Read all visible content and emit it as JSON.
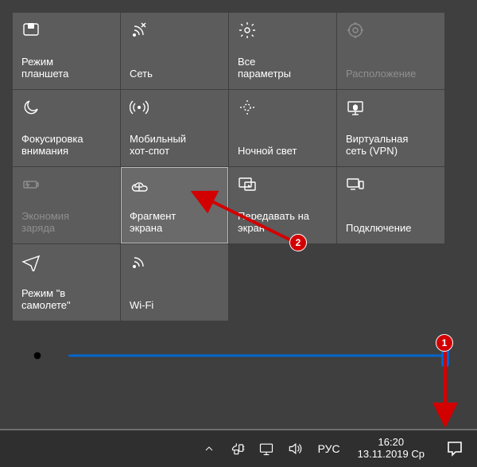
{
  "tiles": [
    {
      "id": "tablet-mode",
      "icon": "tablet-icon",
      "label": "Режим\nпланшета",
      "interactable": true,
      "disabled": false,
      "highlight": false
    },
    {
      "id": "network",
      "icon": "network-icon",
      "label": "Сеть",
      "interactable": true,
      "disabled": false,
      "highlight": false
    },
    {
      "id": "all-settings",
      "icon": "gear-icon",
      "label": "Все\nпараметры",
      "interactable": true,
      "disabled": false,
      "highlight": false
    },
    {
      "id": "location",
      "icon": "location-icon",
      "label": "Расположение",
      "interactable": false,
      "disabled": true,
      "highlight": false
    },
    {
      "id": "focus-assist",
      "icon": "moon-icon",
      "label": "Фокусировка\nвнимания",
      "interactable": true,
      "disabled": false,
      "highlight": false
    },
    {
      "id": "mobile-hotspot",
      "icon": "hotspot-icon",
      "label": "Мобильный\nхот-спот",
      "interactable": true,
      "disabled": false,
      "highlight": false
    },
    {
      "id": "night-light",
      "icon": "nightlight-icon",
      "label": "Ночной свет",
      "interactable": true,
      "disabled": false,
      "highlight": false
    },
    {
      "id": "vpn",
      "icon": "vpn-icon",
      "label": "Виртуальная\nсеть (VPN)",
      "interactable": true,
      "disabled": false,
      "highlight": false
    },
    {
      "id": "battery-saver",
      "icon": "battery-icon",
      "label": "Экономия\nзаряда",
      "interactable": false,
      "disabled": true,
      "highlight": false
    },
    {
      "id": "screen-snip",
      "icon": "snip-icon",
      "label": "Фрагмент\nэкрана",
      "interactable": true,
      "disabled": false,
      "highlight": true
    },
    {
      "id": "project",
      "icon": "project-icon",
      "label": "Передавать на\nэкран",
      "interactable": true,
      "disabled": false,
      "highlight": false
    },
    {
      "id": "connect",
      "icon": "connect-icon",
      "label": "Подключение",
      "interactable": true,
      "disabled": false,
      "highlight": false
    },
    {
      "id": "airplane-mode",
      "icon": "airplane-icon",
      "label": "Режим \"в\nсамолете\"",
      "interactable": true,
      "disabled": false,
      "highlight": false
    },
    {
      "id": "wifi",
      "icon": "wifi-icon",
      "label": "Wi-Fi",
      "interactable": true,
      "disabled": false,
      "highlight": false
    }
  ],
  "brightness": {
    "value": 100,
    "min": 0,
    "max": 100
  },
  "taskbar": {
    "chevron_label": "Показать скрытые значки",
    "power_label": "Питание",
    "network_label": "Сеть",
    "volume_label": "Громкость",
    "language": "РУС",
    "time": "16:20",
    "date": "13.11.2019 Ср",
    "action_center_label": "Центр уведомлений"
  },
  "annotations": {
    "badge1": "1",
    "badge2": "2"
  }
}
